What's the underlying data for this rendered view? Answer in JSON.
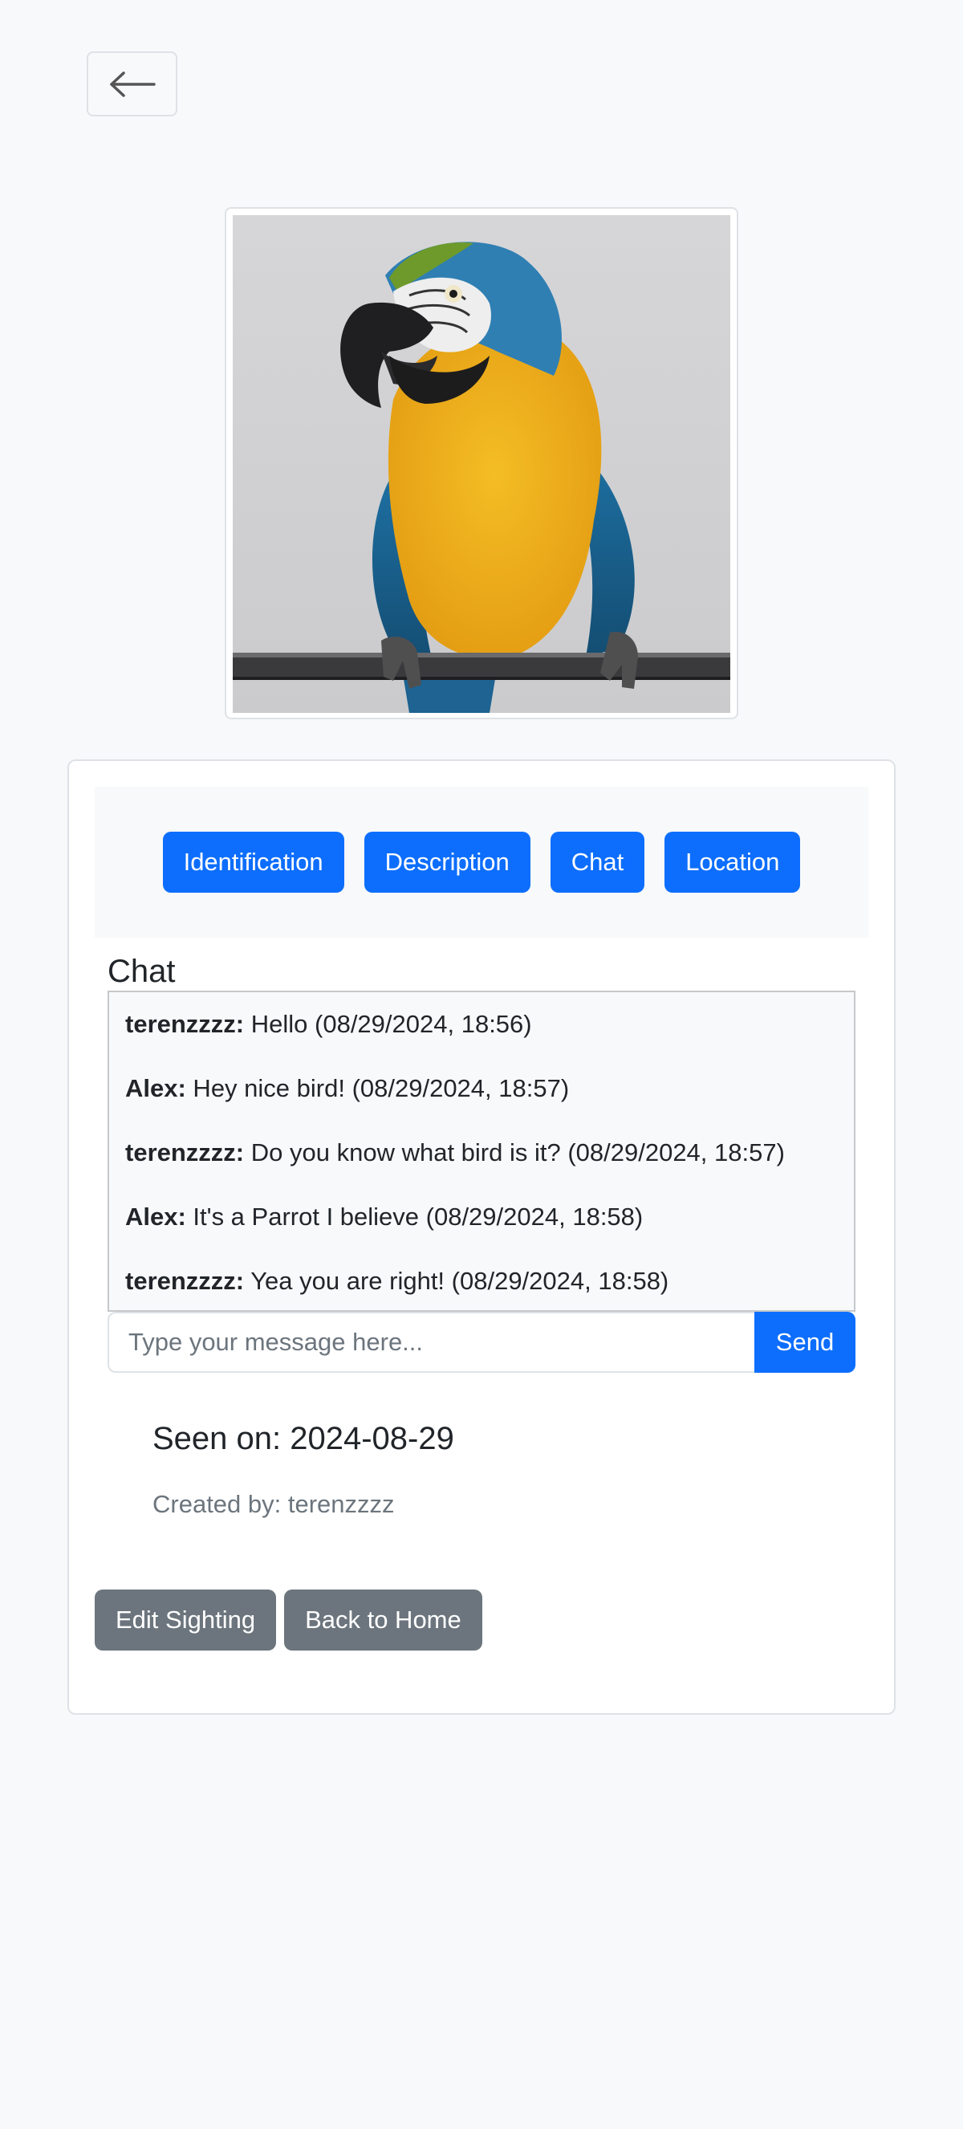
{
  "nav": {
    "back_icon": "arrow-left-icon"
  },
  "sighting": {
    "photo_subject": "parrot"
  },
  "tabs": [
    {
      "label": "Identification"
    },
    {
      "label": "Description"
    },
    {
      "label": "Chat"
    },
    {
      "label": "Location"
    }
  ],
  "chat": {
    "heading": "Chat",
    "messages": [
      {
        "user": "terenzzzz:",
        "text": " Hello (08/29/2024, 18:56)"
      },
      {
        "user": "Alex:",
        "text": " Hey nice bird! (08/29/2024, 18:57)"
      },
      {
        "user": "terenzzzz:",
        "text": " Do you know what bird is it? (08/29/2024, 18:57)"
      },
      {
        "user": "Alex:",
        "text": " It's a Parrot I believe (08/29/2024, 18:58)"
      },
      {
        "user": "terenzzzz:",
        "text": " Yea you are right! (08/29/2024, 18:58)"
      }
    ],
    "input_placeholder": "Type your message here...",
    "input_value": "",
    "send_label": "Send"
  },
  "details": {
    "seen_on": "Seen on: 2024-08-29",
    "created_by": "Created by: terenzzzz"
  },
  "actions": {
    "edit_label": "Edit Sighting",
    "home_label": "Back to Home"
  },
  "colors": {
    "primary": "#0d6efd",
    "secondary": "#6c757d",
    "page_bg": "#f8f9fb"
  }
}
